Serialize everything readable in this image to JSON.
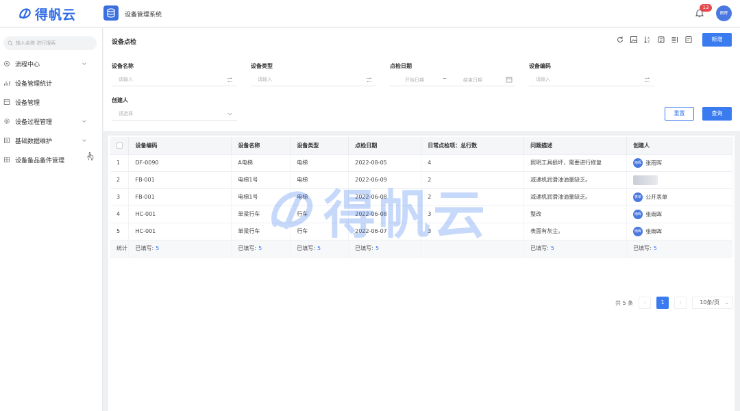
{
  "header": {
    "logo_text": "得帆云",
    "app_title": "设备管理系统",
    "notification_count": "13",
    "user_avatar": "雨晖"
  },
  "sidebar": {
    "search_placeholder": "输入名称 进行搜索",
    "items": [
      {
        "label": "流程中心",
        "icon": "process-icon",
        "expandable": true
      },
      {
        "label": "设备管理统计",
        "icon": "stats-icon",
        "expandable": false
      },
      {
        "label": "设备管理",
        "icon": "device-icon",
        "expandable": false
      },
      {
        "label": "设备过程管理",
        "icon": "gear-icon",
        "expandable": true
      },
      {
        "label": "基础数据维护",
        "icon": "data-icon",
        "expandable": true
      },
      {
        "label": "设备备品备件管理",
        "icon": "parts-icon",
        "expandable": false
      }
    ]
  },
  "panel": {
    "title": "设备点检",
    "new_button": "新增",
    "reset_button": "重置",
    "query_button": "查询",
    "toolbar_icons": [
      "refresh-icon",
      "image-icon",
      "sort-icon",
      "print-icon",
      "column-settings-icon",
      "export-icon"
    ]
  },
  "filters": {
    "device_name": {
      "label": "设备名称",
      "placeholder": "请输入"
    },
    "device_type": {
      "label": "设备类型",
      "placeholder": "请输入"
    },
    "inspect_date": {
      "label": "点检日期",
      "start": "开始日期",
      "separator": "~",
      "end": "结束日期"
    },
    "device_code": {
      "label": "设备编码",
      "placeholder": "请输入"
    },
    "creator": {
      "label": "创建人",
      "placeholder": "请选择"
    }
  },
  "table": {
    "headers": [
      "设备编码",
      "设备名称",
      "设备类型",
      "点检日期",
      "日常点检项：总行数",
      "问题描述",
      "创建人"
    ],
    "rows": [
      {
        "idx": "1",
        "code": "DF-0090",
        "name": "A电梯",
        "type": "电梯",
        "date": "2022-08-05",
        "count": "4",
        "desc": "照明工具损坏，需要进行修复",
        "creator": "张雨晖",
        "avatar": "雨晖",
        "blurred": false
      },
      {
        "idx": "2",
        "code": "FB-001",
        "name": "电梯1号",
        "type": "电梯",
        "date": "2022-06-09",
        "count": "2",
        "desc": "减速机润滑油油量缺乏。",
        "creator": "",
        "avatar": "",
        "blurred": true
      },
      {
        "idx": "3",
        "code": "FB-001",
        "name": "电梯1号",
        "type": "电梯",
        "date": "2022-06-08",
        "count": "2",
        "desc": "减速机润滑油油量缺乏。",
        "creator": "公开表单",
        "avatar": "表单",
        "blurred": false
      },
      {
        "idx": "4",
        "code": "HC-001",
        "name": "单梁行车",
        "type": "行车",
        "date": "2022-06-08",
        "count": "3",
        "desc": "整改",
        "creator": "张雨晖",
        "avatar": "雨晖",
        "blurred": false
      },
      {
        "idx": "5",
        "code": "HC-001",
        "name": "单梁行车",
        "type": "行车",
        "date": "2022-06-07",
        "count": "3",
        "desc": "表面有灰尘。",
        "creator": "张雨晖",
        "avatar": "雨晖",
        "blurred": false
      }
    ],
    "summary": {
      "label": "统计",
      "filled_label": "已填写:",
      "filled_value": "5"
    }
  },
  "pagination": {
    "total_text": "共 5 条",
    "prev": "‹",
    "current_page": "1",
    "next": "›",
    "page_size": "10条/页"
  },
  "watermark": {
    "text": "得帆云"
  },
  "colors": {
    "primary": "#3b7bf0",
    "badge": "#e5484d",
    "avatar": "#4a78e0"
  }
}
